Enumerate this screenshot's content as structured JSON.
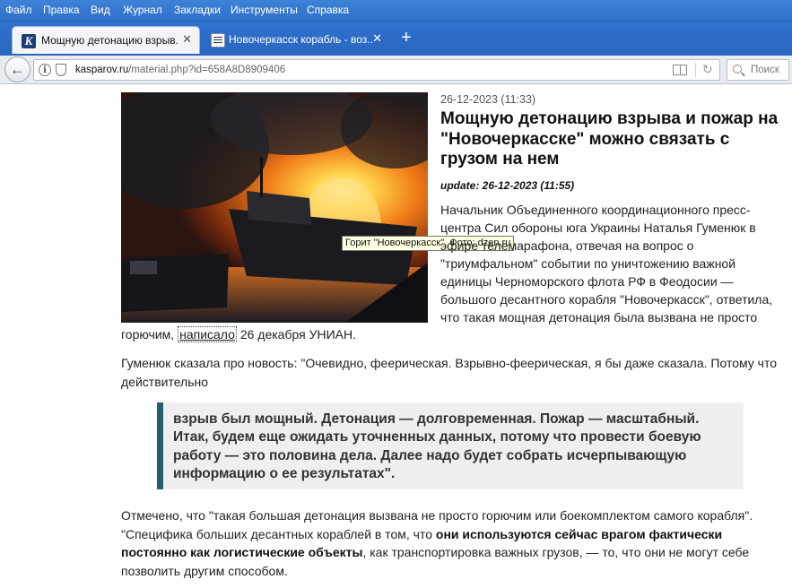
{
  "menu": [
    "Файл",
    "Правка",
    "Вид",
    "Журнал",
    "Закладки",
    "Инструменты",
    "Справка"
  ],
  "tabs": [
    {
      "title": "Мощную детонацию взрыв...",
      "favicon": "kasparov-logo",
      "active": true
    },
    {
      "title": "Новочеркасск корабль - воз...",
      "favicon": "document-icon",
      "active": false
    }
  ],
  "newtab": "+",
  "close_glyph": "✕",
  "kasparov_letter": "K",
  "address": {
    "domain": "kasparov.ru",
    "path": "/material.php?id=658A8D8909406"
  },
  "search": {
    "placeholder": "Поиск"
  },
  "article": {
    "date": "26-12-2023 (11:33)",
    "title": "Мощную детонацию взрыва и пожар на \"Новочеркасске\" можно связать с грузом на нем",
    "update": "update: 26-12-2023 (11:55)",
    "photo_caption": "Горит \"Новочеркасск\". Фото: dzen.ru",
    "lead_lines": [
      "Начальник Объединенного координационного пресс-",
      "центра Сил обороны юга Украины Наталья Гуменюк в",
      "эфире телемарафона, отвечая на вопрос о",
      "\"триумфальном\" событии по уничтожению важной",
      "единицы Черноморского флота РФ в Феодосии —",
      "большого десантного корабля \"Новочеркасск\", ответила,",
      "что такая мощная детонация была вызвана не просто"
    ],
    "lead_end_before": "горючим,",
    "lead_link": "написало",
    "lead_end_after": "26 декабря УНИАН.",
    "para2": "Гуменюк сказала про новость: \"Очевидно, феерическая. Взрывно-феерическая, я бы даже сказала. Потому что действительно",
    "quote": "взрыв был мощный. Детонация — долговременная. Пожар — масштабный. Итак, будем еще ожидать уточненных данных, потому что провести боевую работу — это половина дела. Далее надо будет собрать исчерпывающую информацию о ее результатах\".",
    "para3_a": "Отмечено, что \"такая большая детонация вызвана не просто горючим или боекомплектом самого корабля\". \"Специфика больших десантных кораблей в том, что ",
    "para3_b": "они используются сейчас врагом фактически постоянно как логистические объекты",
    "para3_c": ", как транспортировка важных грузов, — то, что они не могут себе позволить другим способом."
  },
  "colors": {
    "menubar": "#3f83d8",
    "tabstrip": "#2f72cf",
    "quote_border": "#22616e",
    "quote_bg": "#efefef",
    "tooltip_bg": "#ffffe1"
  }
}
